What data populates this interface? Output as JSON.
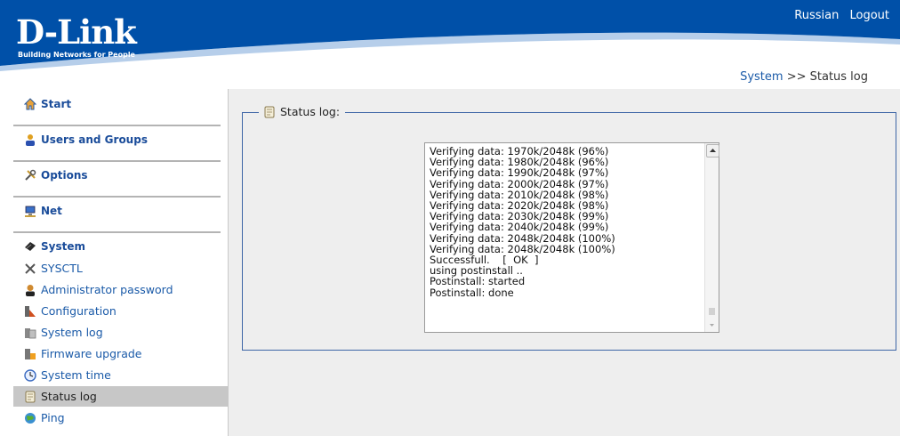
{
  "header": {
    "logo": "D-Link",
    "tagline": "Building Networks for People",
    "links": [
      "Russian",
      "Logout"
    ],
    "breadcrumb": {
      "link": "System",
      "sep": " >> ",
      "current": "Status log"
    },
    "brand_color": "#0050a8"
  },
  "sidebar": {
    "sections": [
      {
        "label": "Start",
        "icon": "home-icon"
      },
      {
        "label": "Users and Groups",
        "icon": "users-icon"
      },
      {
        "label": "Options",
        "icon": "tools-icon"
      },
      {
        "label": "Net",
        "icon": "network-icon"
      }
    ],
    "system": {
      "label": "System",
      "icon": "system-icon",
      "items": [
        {
          "label": "SYSCTL",
          "icon": "wrench-icon"
        },
        {
          "label": "Administrator password",
          "icon": "admin-icon"
        },
        {
          "label": "Configuration",
          "icon": "configuration-icon"
        },
        {
          "label": "System log",
          "icon": "system-log-icon"
        },
        {
          "label": "Firmware upgrade",
          "icon": "firmware-icon"
        },
        {
          "label": "System time",
          "icon": "clock-icon"
        },
        {
          "label": "Status log",
          "icon": "status-log-icon",
          "active": true
        },
        {
          "label": "Ping",
          "icon": "ping-icon"
        }
      ]
    }
  },
  "main": {
    "legend": "Status log:",
    "log_text": "Verifying data: 1970k/2048k (96%)\nVerifying data: 1980k/2048k (96%)\nVerifying data: 1990k/2048k (97%)\nVerifying data: 2000k/2048k (97%)\nVerifying data: 2010k/2048k (98%)\nVerifying data: 2020k/2048k (98%)\nVerifying data: 2030k/2048k (99%)\nVerifying data: 2040k/2048k (99%)\nVerifying data: 2048k/2048k (100%)\nVerifying data: 2048k/2048k (100%)\nSuccessfull.    [  OK  ]\nusing postinstall ..\nPostinstall: started\nPostinstall: done"
  }
}
